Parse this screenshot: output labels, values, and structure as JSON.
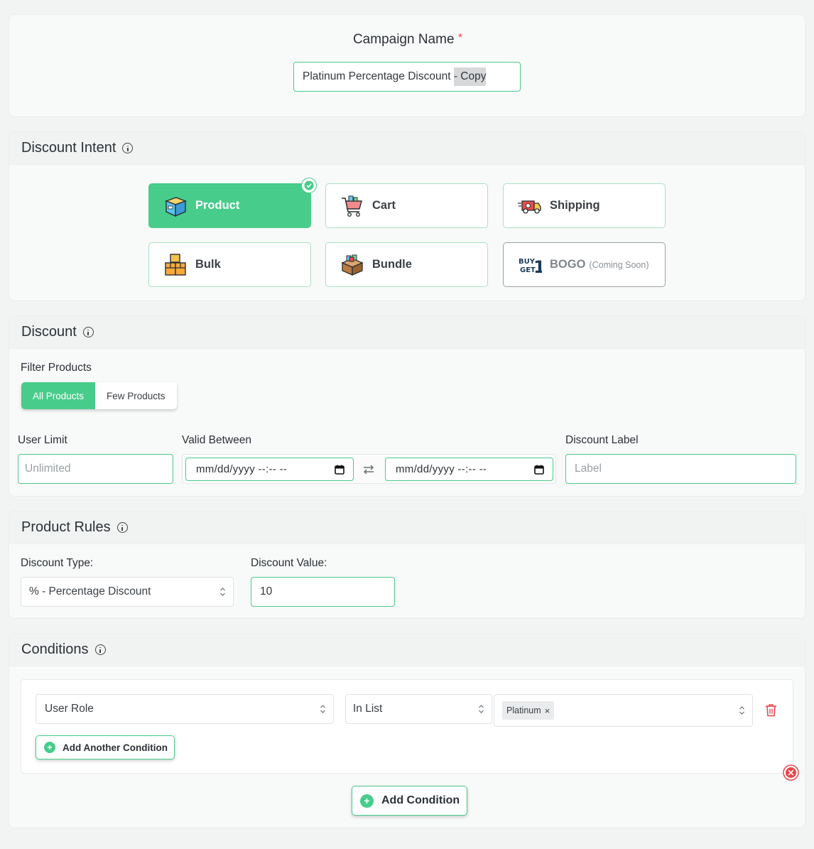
{
  "campaign": {
    "label": "Campaign Name",
    "required_mark": "*",
    "value_main": "Platinum Percentage Discount ",
    "value_selected": "- Copy"
  },
  "intent": {
    "title": "Discount Intent",
    "options": [
      {
        "label": "Product",
        "icon": "box-icon",
        "selected": true
      },
      {
        "label": "Cart",
        "icon": "cart-icon",
        "selected": false
      },
      {
        "label": "Shipping",
        "icon": "truck-icon",
        "selected": false
      },
      {
        "label": "Bulk",
        "icon": "boxes-icon",
        "selected": false
      },
      {
        "label": "Bundle",
        "icon": "bundle-icon",
        "selected": false
      },
      {
        "label": "BOGO",
        "note": "(Coming Soon)",
        "icon": "buy-get-icon",
        "selected": false
      }
    ]
  },
  "discount": {
    "title": "Discount",
    "filter_label": "Filter Products",
    "filter_options": [
      "All Products",
      "Few Products"
    ],
    "filter_selected": "All Products",
    "user_limit_label": "User Limit",
    "user_limit_placeholder": "Unlimited",
    "valid_between_label": "Valid Between",
    "date_placeholder_start": "mm/dd/yyyy --:-- --",
    "date_placeholder_end": "mm/dd/yyyy --:-- --",
    "discount_label_label": "Discount Label",
    "discount_label_placeholder": "Label"
  },
  "rules": {
    "title": "Product Rules",
    "type_label": "Discount Type:",
    "type_value": "% - Percentage Discount",
    "value_label": "Discount Value:",
    "value": "10"
  },
  "conditions": {
    "title": "Conditions",
    "row": {
      "field": "User Role",
      "operator": "In List",
      "tags": [
        "Platinum"
      ],
      "tag_remove": "×"
    },
    "add_another_label": "Add Another Condition",
    "add_condition_label": "Add Condition"
  },
  "colors": {
    "accent": "#48cc8b",
    "danger": "#e5484d"
  }
}
